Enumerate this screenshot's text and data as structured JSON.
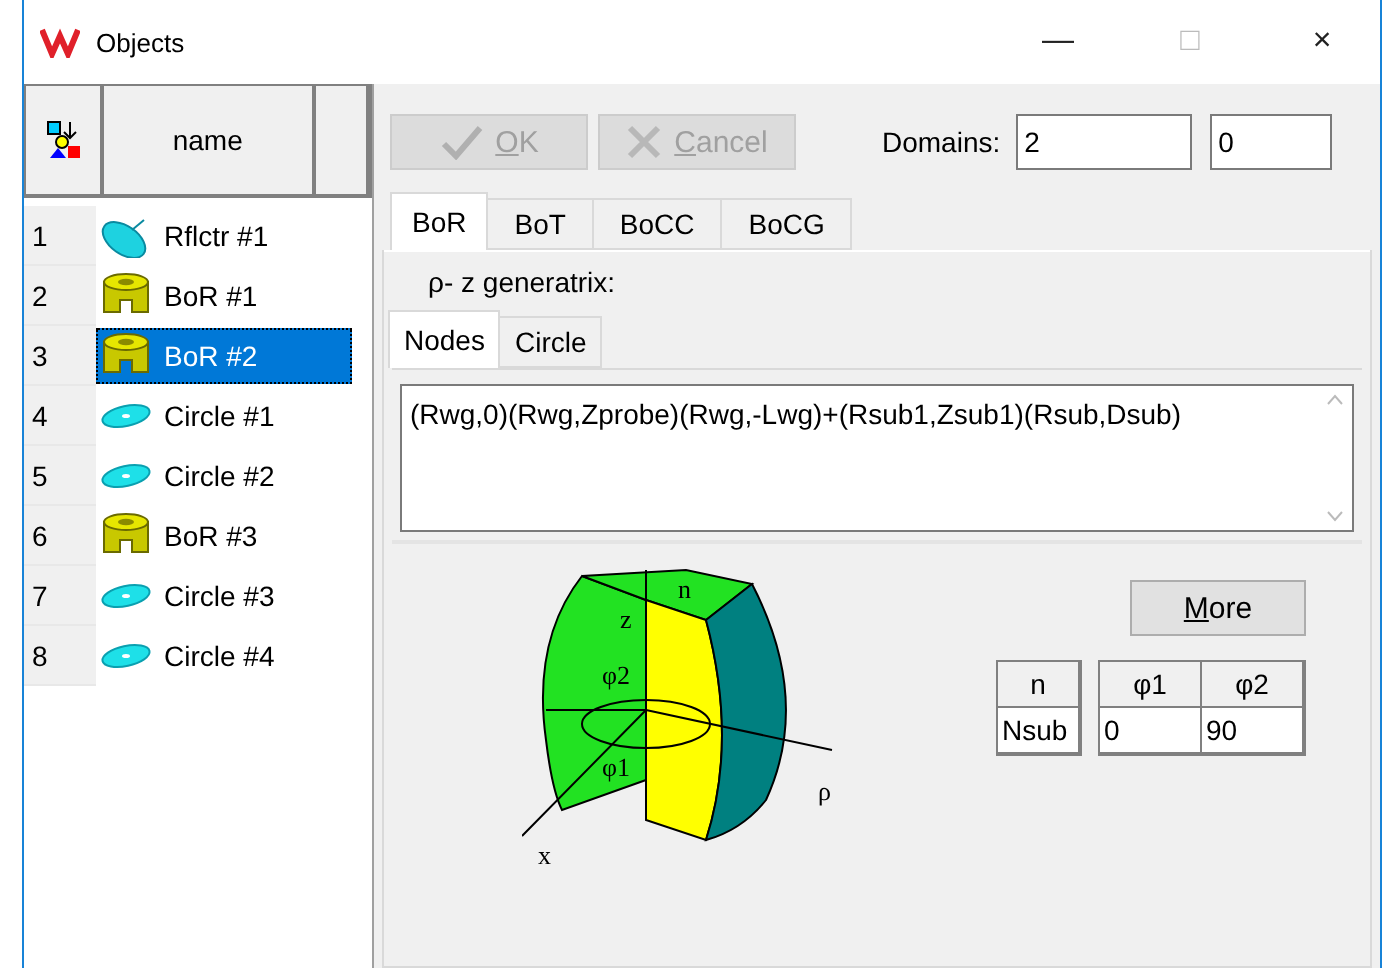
{
  "window": {
    "title": "Objects",
    "controls": [
      "—",
      "□",
      "×"
    ]
  },
  "object_list": {
    "columns": [
      "name",
      ""
    ],
    "rows": [
      {
        "index": "1",
        "name": "Rflctr #1",
        "kind": "reflector",
        "selected": false
      },
      {
        "index": "2",
        "name": "BoR #1",
        "kind": "bor",
        "selected": false
      },
      {
        "index": "3",
        "name": "BoR #2",
        "kind": "bor",
        "selected": true
      },
      {
        "index": "4",
        "name": "Circle #1",
        "kind": "circle",
        "selected": false
      },
      {
        "index": "5",
        "name": "Circle #2",
        "kind": "circle",
        "selected": false
      },
      {
        "index": "6",
        "name": "BoR #3",
        "kind": "bor",
        "selected": false
      },
      {
        "index": "7",
        "name": "Circle #3",
        "kind": "circle",
        "selected": false
      },
      {
        "index": "8",
        "name": "Circle #4",
        "kind": "circle",
        "selected": false
      }
    ]
  },
  "toolbar": {
    "buttons": [
      {
        "label": "OK",
        "disabled": true
      },
      {
        "label": "Cancel",
        "disabled": true
      }
    ],
    "domains": {
      "label": "Domains:",
      "values": [
        "2",
        "0"
      ]
    }
  },
  "tabs": [
    {
      "label": "BoR",
      "selected": true
    },
    {
      "label": "BoT",
      "selected": false
    },
    {
      "label": "BoCC",
      "selected": false
    },
    {
      "label": "BoCG",
      "selected": false
    }
  ],
  "generatrix": {
    "label": "ρ- z generatrix:",
    "tabs": [
      {
        "label": "Nodes",
        "selected": true
      },
      {
        "label": "Circle",
        "selected": false
      }
    ],
    "text": "(Rwg,0)(Rwg,Zprobe)(Rwg,-Lwg)+(Rsub1,Zsub1)(Rsub,Dsub)"
  },
  "diagram": {
    "labels": [
      "z",
      "n",
      "φ2",
      "φ1",
      "x",
      "ρ"
    ]
  },
  "more_button": {
    "label": "More"
  },
  "params": {
    "n": {
      "header": "n",
      "value": "Nsub"
    },
    "phi": {
      "headers": [
        "φ1",
        "φ2"
      ],
      "values": [
        "0",
        "90"
      ]
    }
  }
}
